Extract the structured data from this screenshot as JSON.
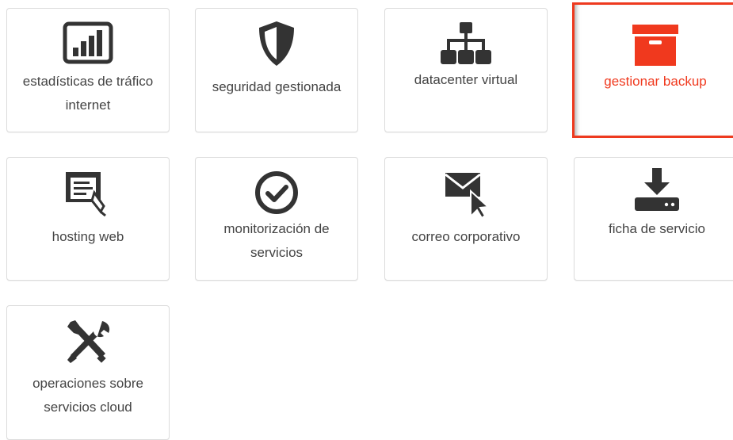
{
  "accent_color": "#f0391e",
  "icon_color": "#333333",
  "tiles": [
    {
      "label": "estadísticas de tráfico internet",
      "icon": "bar-chart-icon"
    },
    {
      "label": "seguridad gestionada",
      "icon": "shield-icon"
    },
    {
      "label": "datacenter virtual",
      "icon": "sitemap-icon"
    },
    {
      "label": "gestionar backup",
      "icon": "archive-box-icon",
      "selected": true
    },
    {
      "label": "hosting web",
      "icon": "web-hosting-icon"
    },
    {
      "label": "monitorización de servicios",
      "icon": "check-circle-icon"
    },
    {
      "label": "correo corporativo",
      "icon": "mail-cursor-icon"
    },
    {
      "label": "ficha de servicio",
      "icon": "download-drive-icon"
    },
    {
      "label": "operaciones sobre servicios cloud",
      "icon": "tools-icon"
    }
  ]
}
